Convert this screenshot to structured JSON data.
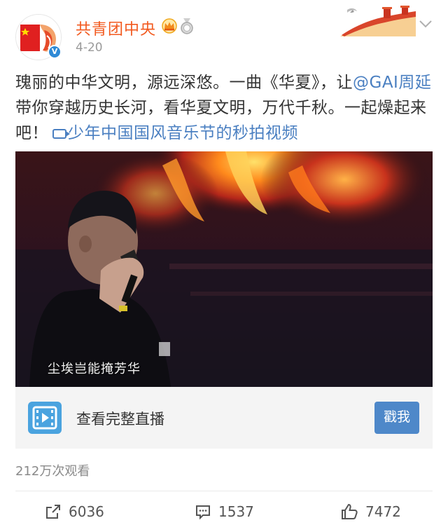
{
  "header": {
    "account_name": "共青团中央",
    "date": "4-20",
    "verified_mark": "V"
  },
  "post": {
    "text_part1": "瑰丽的中华文明，源远深悠。一曲《华夏》，让",
    "mention": "@GAI周延",
    "text_part2": " 带你穿越历史长河，看华夏文明，万代千秋。一起燥起来吧！",
    "video_link": "少年中国国风音乐节的秒拍视频"
  },
  "video": {
    "subtitle": "尘埃岂能掩芳华"
  },
  "live_card": {
    "label": "查看完整直播",
    "button": "戳我"
  },
  "stats": {
    "views": "212万次观看",
    "shares": "6036",
    "comments": "1537",
    "likes": "7472"
  },
  "colors": {
    "name": "#f25a1f",
    "link": "#4a7fc1",
    "button": "#4e88c9",
    "live_icon": "#4aa3df"
  }
}
